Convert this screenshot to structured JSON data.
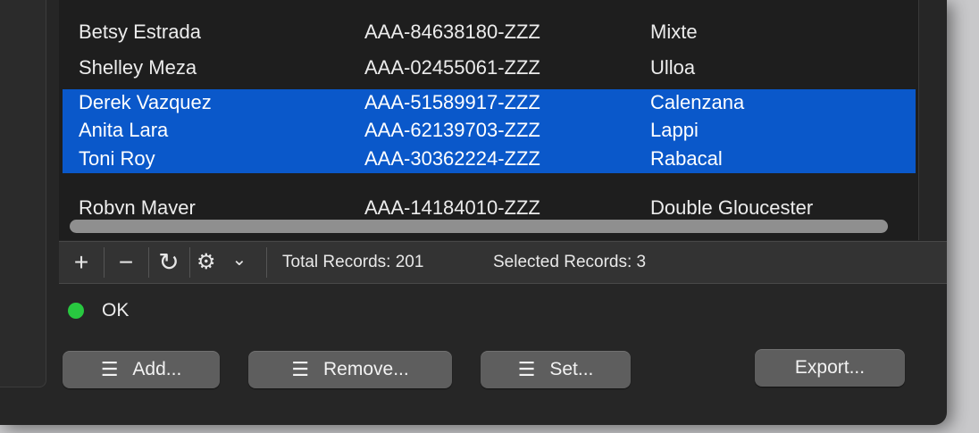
{
  "table": {
    "rows": [
      {
        "name": "Betsy Estrada",
        "id": "AAA-84638180-ZZZ",
        "city": "Mixte",
        "selected": false
      },
      {
        "name": "Shelley Meza",
        "id": "AAA-02455061-ZZZ",
        "city": "Ulloa",
        "selected": false
      },
      {
        "name": "Derek Vazquez",
        "id": "AAA-51589917-ZZZ",
        "city": "Calenzana",
        "selected": true
      },
      {
        "name": "Anita Lara",
        "id": "AAA-62139703-ZZZ",
        "city": "Lappi",
        "selected": true
      },
      {
        "name": "Toni Roy",
        "id": "AAA-30362224-ZZZ",
        "city": "Rabacal",
        "selected": true
      },
      {
        "name": "Robyn Mayer",
        "id": "AAA-14184010-ZZZ",
        "city": "Double Gloucester",
        "selected": false
      }
    ]
  },
  "toolbar": {
    "add_symbol": "+",
    "remove_symbol": "−",
    "refresh_symbol": "↻",
    "gear_symbol": "⚙",
    "dropdown_symbol": "⌄",
    "total_records": "Total Records: 201",
    "selected_records": "Selected Records: 3"
  },
  "status": {
    "text": "OK",
    "color": "#28c840"
  },
  "buttons": {
    "list_icon": "☰",
    "add_label": "Add...",
    "remove_label": "Remove...",
    "set_label": "Set...",
    "export_label": "Export..."
  },
  "colors": {
    "selection": "#0a58ca",
    "window_bg": "#262626"
  }
}
